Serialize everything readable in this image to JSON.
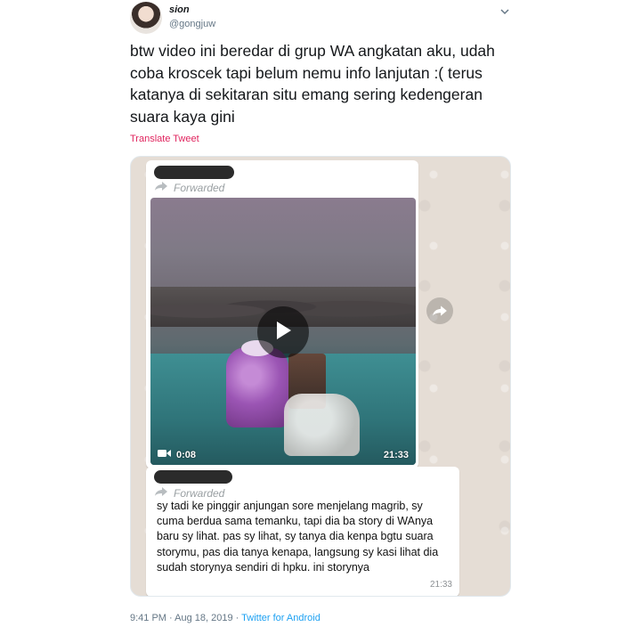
{
  "tweet": {
    "name": "sion",
    "handle": "@gongjuw",
    "text": "btw video ini beredar di grup WA angkatan aku, udah coba kroscek tapi belum nemu info lanjutan :( terus katanya di sekitaran situ emang sering kedengeran suara kaya gini",
    "translate_label": "Translate Tweet",
    "timestamp": "9:41 PM · Aug 18, 2019 · ",
    "source": "Twitter for Android"
  },
  "whatsapp": {
    "forwarded_label": "Forwarded",
    "video_message": {
      "duration": "0:08",
      "time": "21:33"
    },
    "text_message": {
      "body": "sy tadi ke pinggir anjungan sore menjelang magrib, sy cuma berdua sama temanku, tapi dia ba story di WAnya baru sy lihat. pas sy lihat, sy tanya dia kenpa bgtu suara storymu, pas dia tanya kenapa, langsung sy kasi lihat dia sudah storynya sendiri di hpku. ini storynya",
      "time": "21:33"
    }
  },
  "icons": [
    "chevron-down-icon",
    "forward-arrow-icon",
    "play-icon",
    "video-camera-icon",
    "share-forward-icon"
  ],
  "colors": {
    "link_pink": "#e0245e",
    "source_blue": "#1da1f2",
    "wa_background": "#e5ddd5"
  }
}
